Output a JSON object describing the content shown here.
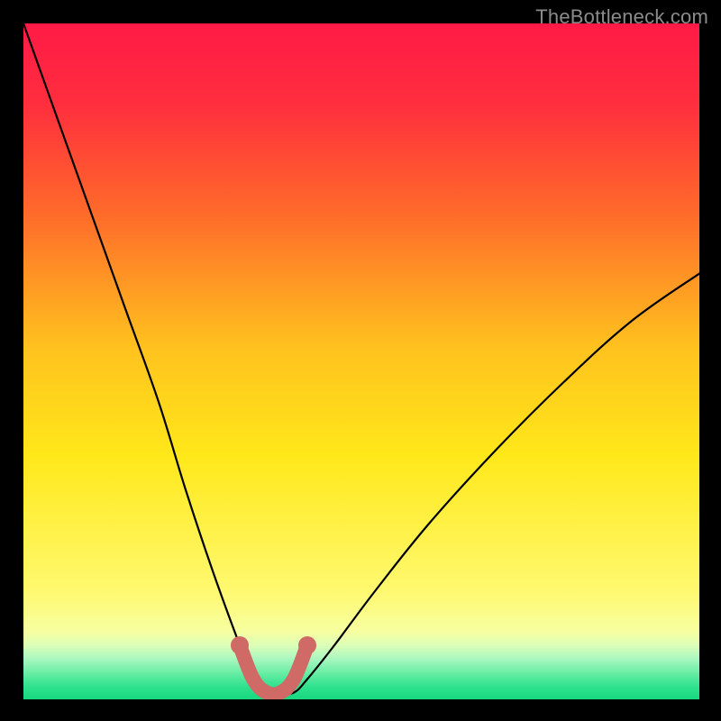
{
  "watermark": "TheBottleneck.com",
  "chart_data": {
    "type": "line",
    "title": "",
    "xlabel": "",
    "ylabel": "",
    "xlim": [
      0,
      100
    ],
    "ylim": [
      0,
      100
    ],
    "series": [
      {
        "name": "bottleneck-curve",
        "x": [
          0,
          5,
          10,
          15,
          20,
          24,
          28,
          32,
          34,
          36,
          38,
          40,
          42,
          46,
          52,
          60,
          70,
          80,
          90,
          100
        ],
        "values": [
          100,
          86,
          72,
          58,
          44,
          31,
          19,
          8,
          3,
          1,
          1,
          1,
          3,
          8,
          16,
          26,
          37,
          47,
          56,
          63
        ]
      }
    ],
    "highlight_segment": {
      "name": "minimum-zone",
      "x": [
        32,
        34,
        36,
        38,
        40,
        42
      ],
      "values": [
        8,
        3,
        1,
        1,
        3,
        8
      ]
    },
    "background": {
      "type": "vertical-gradient",
      "stops": [
        {
          "pos": 0.0,
          "color": "#ff1a46"
        },
        {
          "pos": 0.12,
          "color": "#ff2e3e"
        },
        {
          "pos": 0.28,
          "color": "#ff6a2a"
        },
        {
          "pos": 0.48,
          "color": "#ffc21e"
        },
        {
          "pos": 0.64,
          "color": "#ffe81a"
        },
        {
          "pos": 0.84,
          "color": "#fff970"
        },
        {
          "pos": 0.9,
          "color": "#f7ffa0"
        },
        {
          "pos": 0.92,
          "color": "#dcffb8"
        },
        {
          "pos": 0.94,
          "color": "#a9f7c0"
        },
        {
          "pos": 0.96,
          "color": "#6ceea6"
        },
        {
          "pos": 0.98,
          "color": "#32e28f"
        },
        {
          "pos": 1.0,
          "color": "#17d87e"
        }
      ]
    }
  }
}
